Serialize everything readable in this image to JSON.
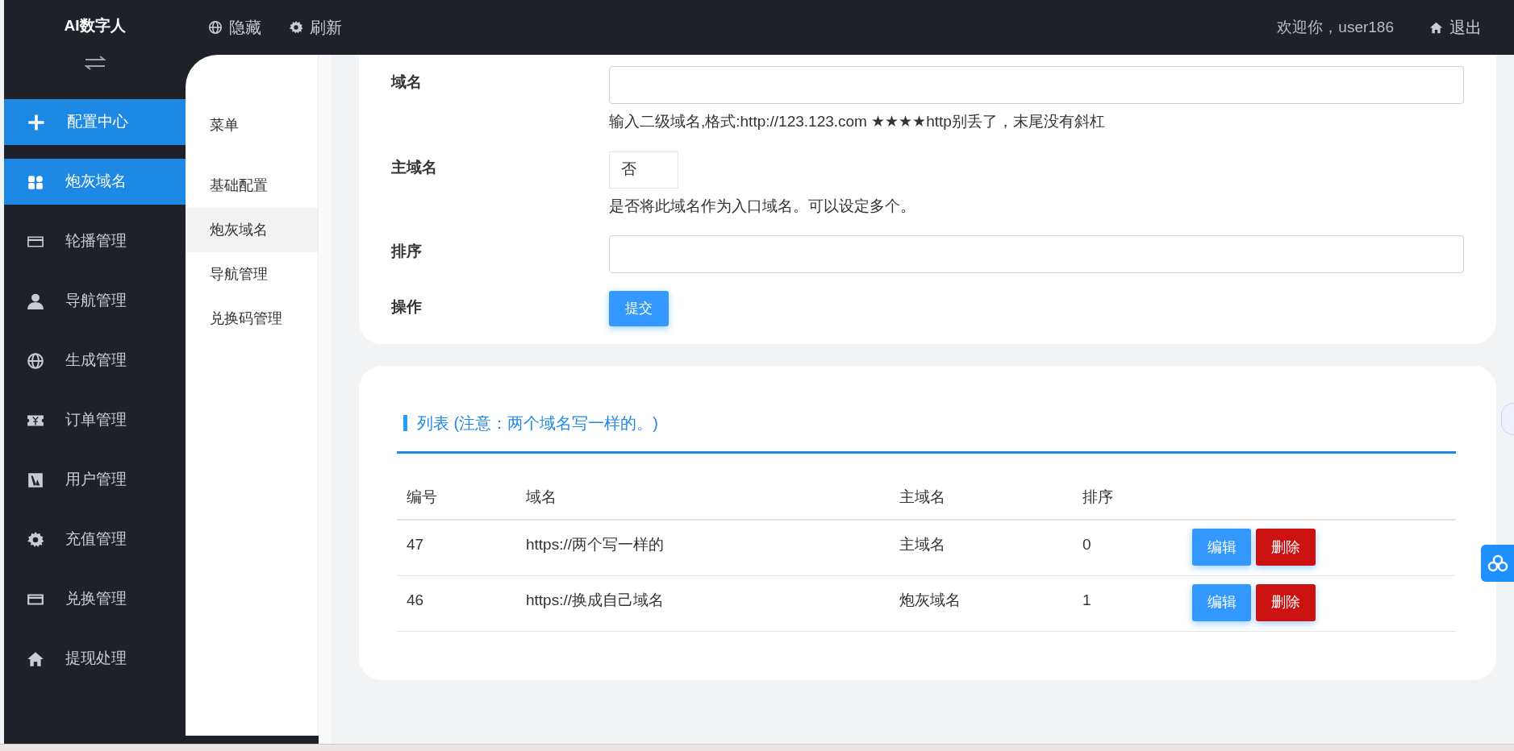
{
  "header": {
    "title": "AI数字人",
    "actions": [
      {
        "label": "隐藏"
      },
      {
        "label": "刷新"
      }
    ],
    "welcome": "欢迎你，user186",
    "logout": "退出"
  },
  "sidebar": {
    "items": [
      {
        "label": "配置中心",
        "selected": true
      },
      {
        "label": "炮灰域名",
        "selected": true
      },
      {
        "label": "轮播管理",
        "selected": false
      },
      {
        "label": "导航管理",
        "selected": false
      },
      {
        "label": "生成管理",
        "selected": false
      },
      {
        "label": "订单管理",
        "selected": false
      },
      {
        "label": "用户管理",
        "selected": false
      },
      {
        "label": "充值管理",
        "selected": false
      },
      {
        "label": "兑换管理",
        "selected": false
      },
      {
        "label": "提现处理",
        "selected": false
      }
    ]
  },
  "submenu": {
    "heading": "菜单",
    "items": [
      {
        "label": "基础配置",
        "selected": false
      },
      {
        "label": "炮灰域名",
        "selected": true
      },
      {
        "label": "导航管理",
        "selected": false
      },
      {
        "label": "兑换码管理",
        "selected": false
      }
    ]
  },
  "form": {
    "rows": [
      {
        "label": "域名",
        "kind": "input",
        "help": "输入二级域名,格式:http://123.123.com ★★★★http别丢了，末尾没有斜杠"
      },
      {
        "label": "主域名",
        "kind": "select",
        "value": "否",
        "help": "是否将此域名作为入口域名。可以设定多个。"
      },
      {
        "label": "排序",
        "kind": "input"
      },
      {
        "label": "操作",
        "kind": "submit",
        "value": "提交"
      }
    ]
  },
  "list": {
    "title": "列表 (注意：两个域名写一样的。)",
    "columns": [
      "编号",
      "域名",
      "主域名",
      "排序"
    ],
    "rows": [
      {
        "cells": [
          "47",
          "https://两个写一样的",
          "主域名",
          "0"
        ],
        "edit": "编辑",
        "delete": "删除"
      },
      {
        "cells": [
          "46",
          "https://换成自己域名",
          "炮灰域名",
          "1"
        ],
        "edit": "编辑",
        "delete": "删除"
      }
    ]
  }
}
